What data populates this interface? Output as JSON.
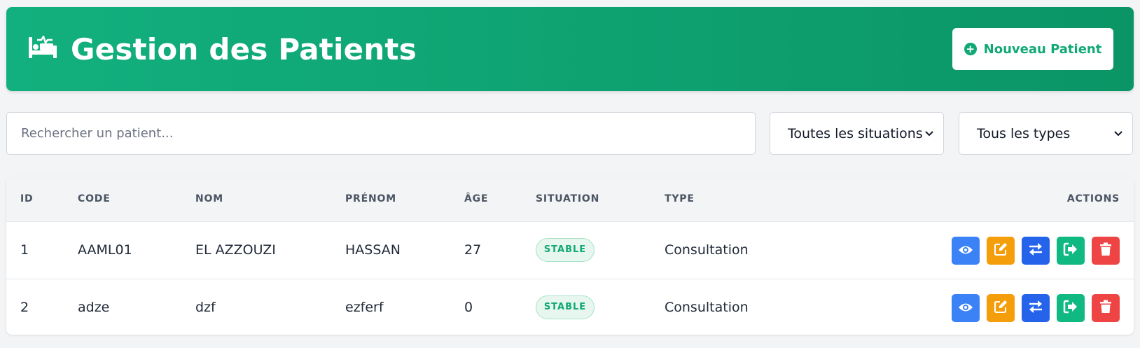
{
  "header": {
    "title": "Gestion des Patients",
    "icon": "hospital-bed-icon",
    "new_button_label": "Nouveau Patient",
    "new_button_icon": "plus-circle-icon"
  },
  "filters": {
    "search_placeholder": "Rechercher un patient...",
    "situation_selected": "Toutes les situations",
    "type_selected": "Tous les types"
  },
  "table": {
    "columns": [
      "ID",
      "CODE",
      "NOM",
      "PRÉNOM",
      "ÂGE",
      "SITUATION",
      "TYPE",
      "ACTIONS"
    ],
    "rows": [
      {
        "id": "1",
        "code": "AAML01",
        "nom": "EL AZZOUZI",
        "prenom": "HASSAN",
        "age": "27",
        "situation": "STABLE",
        "type": "Consultation"
      },
      {
        "id": "2",
        "code": "adze",
        "nom": "dzf",
        "prenom": "ezferf",
        "age": "0",
        "situation": "STABLE",
        "type": "Consultation"
      }
    ],
    "action_icons": [
      "eye-icon",
      "edit-icon",
      "transfer-icon",
      "exit-icon",
      "trash-icon"
    ]
  },
  "colors": {
    "header_green": "#10a874",
    "view_blue": "#3b82f6",
    "edit_orange": "#f59e0b",
    "transfer_blue": "#2563eb",
    "exit_green": "#10b981",
    "delete_red": "#ef4444"
  }
}
